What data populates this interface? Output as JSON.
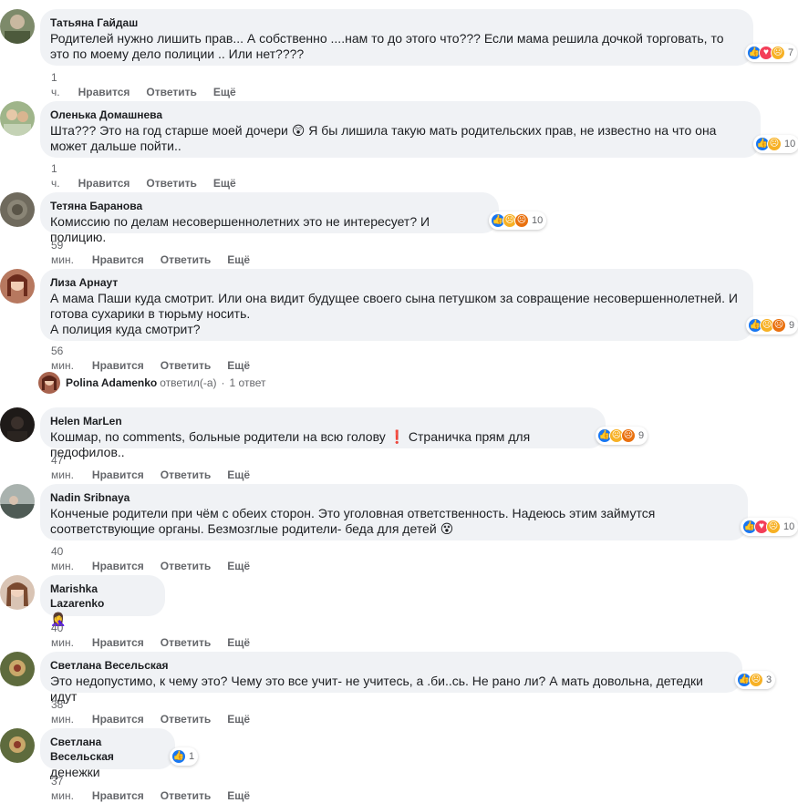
{
  "actions": {
    "like": "Нравится",
    "reply": "Ответить",
    "more": "Ещё"
  },
  "colors": {
    "bubble": "#f0f2f5",
    "like": "#1877f2",
    "love": "#f33e58",
    "sad": "#f7b125",
    "angry": "#e9710f",
    "secondary_text": "#65676b"
  },
  "comments": [
    {
      "author": "Татьяна Гайдаш",
      "text": "Родителей нужно лишить прав... А собственно ....нам то до этого что??? Если мама решила дочкой торговать, то\nэто по моему дело полиции .. Или нет????",
      "time": "1 ч.",
      "reactions": [
        "like",
        "love",
        "sad"
      ],
      "reaction_count": "7"
    },
    {
      "author": "Оленька Домашнева",
      "text_before": "Шта??? Это на год старше моей дочери",
      "emoji": "😲",
      "text_after": "Я бы лишила такую мать родительских прав, не известно на что она\nможет дальше пойти..",
      "time": "1 ч.",
      "reactions": [
        "like",
        "sad"
      ],
      "reaction_count": "10"
    },
    {
      "author": "Тетяна Баранова",
      "text": "Комиссию по делам несовершеннолетних это не интересует? И полицию.",
      "time": "59 мин.",
      "reactions": [
        "like",
        "sad",
        "angry"
      ],
      "reaction_count": "10"
    },
    {
      "author": "Лиза Арнаут",
      "text": "А мама Паши куда смотрит. Или она видит будущее своего сына петушком за совращение несовершеннолетней. И\nготова сухарики в тюрьму носить.\nА полиция куда смотрит?",
      "time": "56 мин.",
      "reactions": [
        "like",
        "sad",
        "angry"
      ],
      "reaction_count": "9"
    },
    {
      "author": "Helen MarLen",
      "text": "Кошмар, no comments, больные родители на всю голову ❗ Страничка прям для педофилов..",
      "time": "47 мин.",
      "reactions": [
        "like",
        "sad",
        "angry"
      ],
      "reaction_count": "9"
    },
    {
      "author": "Nadin Sribnaya",
      "text_before": "Конченые родители при чём с обеих сторон. Это уголовная ответственность. Надеюсь этим займутся\nсоответствующие органы. Безмозглые родители- беда для детей",
      "emoji": "😵",
      "time": "40 мин.",
      "reactions": [
        "like",
        "love",
        "sad"
      ],
      "reaction_count": "10"
    },
    {
      "author": "Marishka Lazarenko",
      "emoji": "🤦‍♀️",
      "time": "40 мин."
    },
    {
      "author": "Светлана Весельская",
      "text": "Это недопустимо, к чему это? Чему это все учит- не учитесь, а .би..сь. Не рано ли? А мать довольна, детедки идут",
      "time": "38 мин.",
      "reactions": [
        "like",
        "sad"
      ],
      "reaction_count": "3"
    },
    {
      "author": "Светлана Весельская",
      "text": "денежки",
      "time": "37 мин.",
      "reactions": [
        "like"
      ],
      "reaction_count": "1"
    }
  ],
  "reply_summary": {
    "author": "Polina Adamenko",
    "verb": "ответил(-а)",
    "dot": "·",
    "count_label": "1 ответ"
  }
}
